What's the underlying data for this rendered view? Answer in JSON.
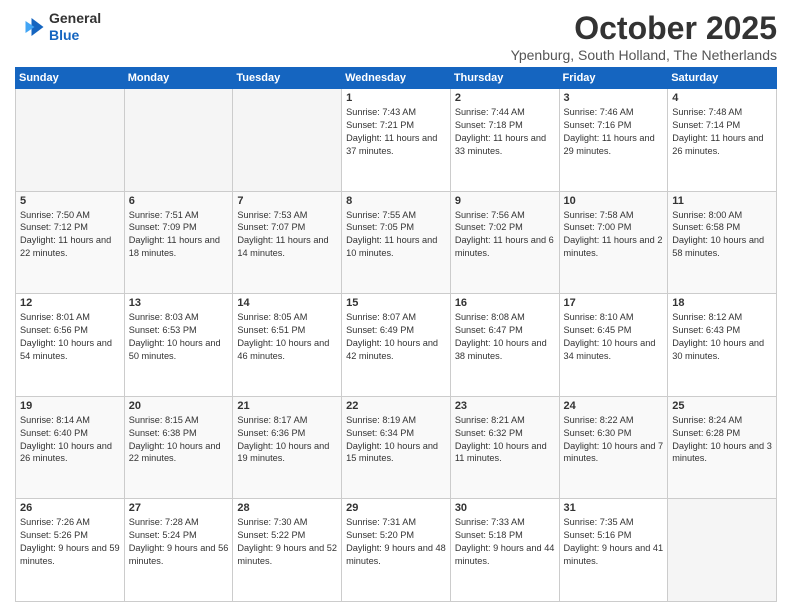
{
  "header": {
    "logo_line1": "General",
    "logo_line2": "Blue",
    "month": "October 2025",
    "location": "Ypenburg, South Holland, The Netherlands"
  },
  "weekdays": [
    "Sunday",
    "Monday",
    "Tuesday",
    "Wednesday",
    "Thursday",
    "Friday",
    "Saturday"
  ],
  "weeks": [
    [
      {
        "day": "",
        "info": ""
      },
      {
        "day": "",
        "info": ""
      },
      {
        "day": "",
        "info": ""
      },
      {
        "day": "1",
        "info": "Sunrise: 7:43 AM\nSunset: 7:21 PM\nDaylight: 11 hours and 37 minutes."
      },
      {
        "day": "2",
        "info": "Sunrise: 7:44 AM\nSunset: 7:18 PM\nDaylight: 11 hours and 33 minutes."
      },
      {
        "day": "3",
        "info": "Sunrise: 7:46 AM\nSunset: 7:16 PM\nDaylight: 11 hours and 29 minutes."
      },
      {
        "day": "4",
        "info": "Sunrise: 7:48 AM\nSunset: 7:14 PM\nDaylight: 11 hours and 26 minutes."
      }
    ],
    [
      {
        "day": "5",
        "info": "Sunrise: 7:50 AM\nSunset: 7:12 PM\nDaylight: 11 hours and 22 minutes."
      },
      {
        "day": "6",
        "info": "Sunrise: 7:51 AM\nSunset: 7:09 PM\nDaylight: 11 hours and 18 minutes."
      },
      {
        "day": "7",
        "info": "Sunrise: 7:53 AM\nSunset: 7:07 PM\nDaylight: 11 hours and 14 minutes."
      },
      {
        "day": "8",
        "info": "Sunrise: 7:55 AM\nSunset: 7:05 PM\nDaylight: 11 hours and 10 minutes."
      },
      {
        "day": "9",
        "info": "Sunrise: 7:56 AM\nSunset: 7:02 PM\nDaylight: 11 hours and 6 minutes."
      },
      {
        "day": "10",
        "info": "Sunrise: 7:58 AM\nSunset: 7:00 PM\nDaylight: 11 hours and 2 minutes."
      },
      {
        "day": "11",
        "info": "Sunrise: 8:00 AM\nSunset: 6:58 PM\nDaylight: 10 hours and 58 minutes."
      }
    ],
    [
      {
        "day": "12",
        "info": "Sunrise: 8:01 AM\nSunset: 6:56 PM\nDaylight: 10 hours and 54 minutes."
      },
      {
        "day": "13",
        "info": "Sunrise: 8:03 AM\nSunset: 6:53 PM\nDaylight: 10 hours and 50 minutes."
      },
      {
        "day": "14",
        "info": "Sunrise: 8:05 AM\nSunset: 6:51 PM\nDaylight: 10 hours and 46 minutes."
      },
      {
        "day": "15",
        "info": "Sunrise: 8:07 AM\nSunset: 6:49 PM\nDaylight: 10 hours and 42 minutes."
      },
      {
        "day": "16",
        "info": "Sunrise: 8:08 AM\nSunset: 6:47 PM\nDaylight: 10 hours and 38 minutes."
      },
      {
        "day": "17",
        "info": "Sunrise: 8:10 AM\nSunset: 6:45 PM\nDaylight: 10 hours and 34 minutes."
      },
      {
        "day": "18",
        "info": "Sunrise: 8:12 AM\nSunset: 6:43 PM\nDaylight: 10 hours and 30 minutes."
      }
    ],
    [
      {
        "day": "19",
        "info": "Sunrise: 8:14 AM\nSunset: 6:40 PM\nDaylight: 10 hours and 26 minutes."
      },
      {
        "day": "20",
        "info": "Sunrise: 8:15 AM\nSunset: 6:38 PM\nDaylight: 10 hours and 22 minutes."
      },
      {
        "day": "21",
        "info": "Sunrise: 8:17 AM\nSunset: 6:36 PM\nDaylight: 10 hours and 19 minutes."
      },
      {
        "day": "22",
        "info": "Sunrise: 8:19 AM\nSunset: 6:34 PM\nDaylight: 10 hours and 15 minutes."
      },
      {
        "day": "23",
        "info": "Sunrise: 8:21 AM\nSunset: 6:32 PM\nDaylight: 10 hours and 11 minutes."
      },
      {
        "day": "24",
        "info": "Sunrise: 8:22 AM\nSunset: 6:30 PM\nDaylight: 10 hours and 7 minutes."
      },
      {
        "day": "25",
        "info": "Sunrise: 8:24 AM\nSunset: 6:28 PM\nDaylight: 10 hours and 3 minutes."
      }
    ],
    [
      {
        "day": "26",
        "info": "Sunrise: 7:26 AM\nSunset: 5:26 PM\nDaylight: 9 hours and 59 minutes."
      },
      {
        "day": "27",
        "info": "Sunrise: 7:28 AM\nSunset: 5:24 PM\nDaylight: 9 hours and 56 minutes."
      },
      {
        "day": "28",
        "info": "Sunrise: 7:30 AM\nSunset: 5:22 PM\nDaylight: 9 hours and 52 minutes."
      },
      {
        "day": "29",
        "info": "Sunrise: 7:31 AM\nSunset: 5:20 PM\nDaylight: 9 hours and 48 minutes."
      },
      {
        "day": "30",
        "info": "Sunrise: 7:33 AM\nSunset: 5:18 PM\nDaylight: 9 hours and 44 minutes."
      },
      {
        "day": "31",
        "info": "Sunrise: 7:35 AM\nSunset: 5:16 PM\nDaylight: 9 hours and 41 minutes."
      },
      {
        "day": "",
        "info": ""
      }
    ]
  ]
}
